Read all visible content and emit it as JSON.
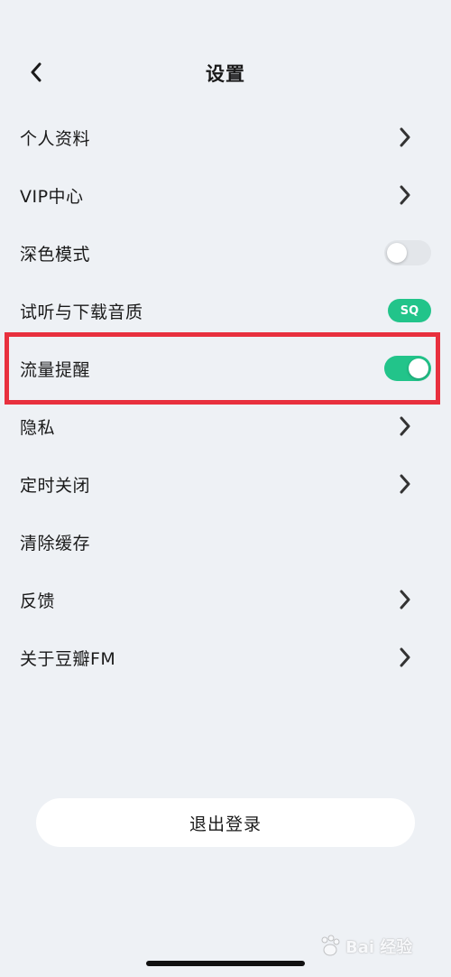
{
  "header": {
    "title": "设置",
    "back_icon": "chevron-left-icon"
  },
  "settings": [
    {
      "label": "个人资料",
      "control": "chevron"
    },
    {
      "label": "VIP中心",
      "control": "chevron"
    },
    {
      "label": "深色模式",
      "control": "toggle",
      "enabled": false
    },
    {
      "label": "试听与下载音质",
      "control": "badge",
      "badge": "SQ"
    },
    {
      "label": "流量提醒",
      "control": "toggle",
      "enabled": true,
      "highlighted": true
    },
    {
      "label": "隐私",
      "control": "chevron"
    },
    {
      "label": "定时关闭",
      "control": "chevron"
    },
    {
      "label": "清除缓存",
      "control": "none"
    },
    {
      "label": "反馈",
      "control": "chevron"
    },
    {
      "label": "关于豆瓣FM",
      "control": "chevron"
    }
  ],
  "logout": {
    "label": "退出登录"
  },
  "watermark": {
    "text": "Bai 经验"
  },
  "colors": {
    "background": "#EEF1F5",
    "accent": "#22C48A",
    "highlight": "#E8303E",
    "toggle_off": "#E3E6EA"
  }
}
